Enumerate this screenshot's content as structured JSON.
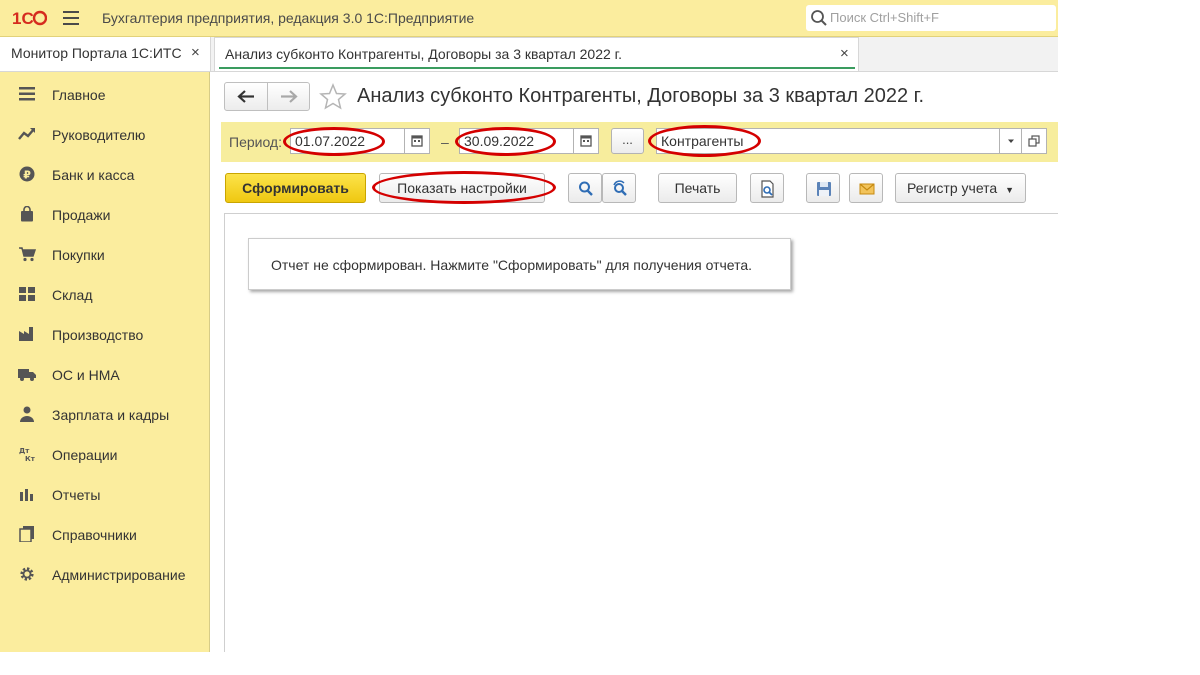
{
  "window": {
    "logo_text": "1С",
    "title": "Бухгалтерия предприятия, редакция 3.0 1С:Предприятие",
    "search_placeholder": "Поиск Ctrl+Shift+F"
  },
  "tabs": [
    {
      "label": "Монитор Портала 1С:ИТС",
      "close": "×",
      "active": false
    },
    {
      "label": "Анализ субконто Контрагенты, Договоры за 3 квартал 2022 г.",
      "close": "×",
      "active": true
    }
  ],
  "sidebar": {
    "items": [
      {
        "label": "Главное",
        "icon": "hamburger-icon"
      },
      {
        "label": "Руководителю",
        "icon": "trend-up-icon"
      },
      {
        "label": "Банк и касса",
        "icon": "ruble-coin-icon"
      },
      {
        "label": "Продажи",
        "icon": "shopping-bag-icon"
      },
      {
        "label": "Покупки",
        "icon": "cart-icon"
      },
      {
        "label": "Склад",
        "icon": "grid-icon"
      },
      {
        "label": "Производство",
        "icon": "factory-icon"
      },
      {
        "label": "ОС и НМА",
        "icon": "truck-icon"
      },
      {
        "label": "Зарплата и кадры",
        "icon": "person-icon"
      },
      {
        "label": "Операции",
        "icon": "dt-kt-icon"
      },
      {
        "label": "Отчеты",
        "icon": "bar-chart-icon"
      },
      {
        "label": "Справочники",
        "icon": "books-icon"
      },
      {
        "label": "Администрирование",
        "icon": "gear-icon"
      }
    ]
  },
  "report": {
    "title": "Анализ субконто Контрагенты, Договоры за 3 квартал 2022 г.",
    "period_label": "Период:",
    "date_from": "01.07.2022",
    "dash": "–",
    "date_to": "30.09.2022",
    "period_button": "...",
    "dimensions_value": "Контрагенты"
  },
  "toolbar": {
    "generate": "Сформировать",
    "show_settings": "Показать настройки",
    "print": "Печать",
    "register": "Регистр учета"
  },
  "message": "Отчет не сформирован. Нажмите \"Сформировать\" для получения отчета.",
  "colors": {
    "panel_yellow": "#fbed9e",
    "generate_button": "#f2cd1c",
    "highlight_red": "#d40000",
    "active_tab_underline": "#3a9c5f"
  }
}
